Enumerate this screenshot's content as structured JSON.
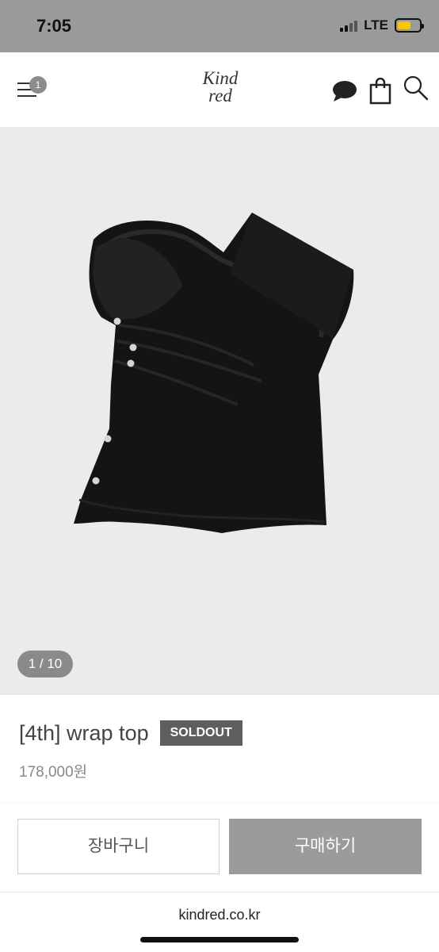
{
  "status_bar": {
    "time": "7:05",
    "network": "LTE",
    "battery_color": "#f7c600"
  },
  "header": {
    "menu_badge_count": "1",
    "logo_line1": "Kind",
    "logo_line2": "red",
    "icons": [
      "menu-icon",
      "chat-bubble-icon",
      "shopping-bag-icon",
      "search-icon"
    ]
  },
  "gallery": {
    "counter": "1 / 10",
    "background": "#ebebeb"
  },
  "product": {
    "title": "[4th] wrap top",
    "status_badge": "SOLDOUT",
    "price": "178,000원"
  },
  "actions": {
    "cart_label": "장바구니",
    "buy_label": "구매하기"
  },
  "browser": {
    "url": "kindred.co.kr"
  }
}
